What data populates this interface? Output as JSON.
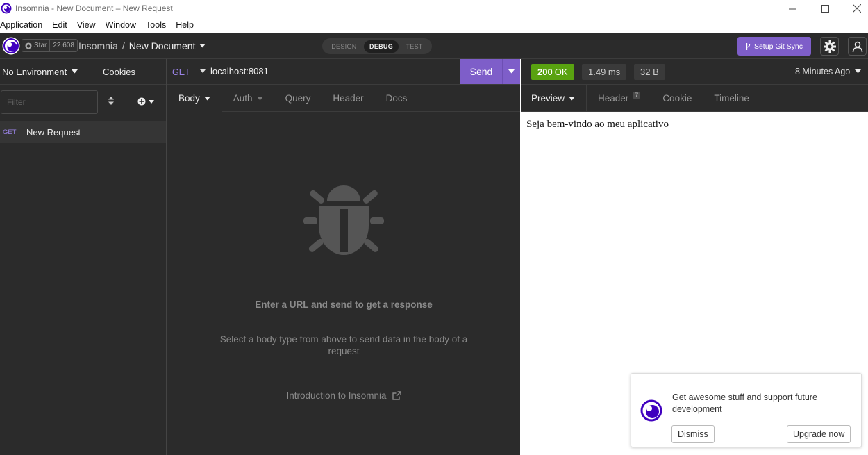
{
  "window": {
    "title": "Insomnia - New Document – New Request"
  },
  "menu": [
    "Application",
    "Edit",
    "View",
    "Window",
    "Tools",
    "Help"
  ],
  "header": {
    "github_star": "Star",
    "github_count": "22.608",
    "workspace": "Insomnia",
    "separator": "/",
    "document": "New Document",
    "modes": [
      "DESIGN",
      "DEBUG",
      "TEST"
    ],
    "active_mode": "DEBUG",
    "git_sync_label": "Setup Git Sync"
  },
  "sidebar": {
    "environment": "No Environment",
    "cookies": "Cookies",
    "filter_placeholder": "Filter",
    "requests": [
      {
        "method": "GET",
        "name": "New Request"
      }
    ]
  },
  "request": {
    "method": "GET",
    "url": "localhost:8081",
    "send_label": "Send",
    "tabs": [
      "Body",
      "Auth",
      "Query",
      "Header",
      "Docs"
    ],
    "empty_title": "Enter a URL and send to get a response",
    "empty_subtitle": "Select a body type from above to send data in the body of a request",
    "intro_link": "Introduction to Insomnia"
  },
  "response": {
    "status_code": "200",
    "status_text": "OK",
    "time": "1.49 ms",
    "size": "32 B",
    "ago": "8 Minutes Ago",
    "tabs": [
      "Preview",
      "Header",
      "Cookie",
      "Timeline"
    ],
    "header_count": "7",
    "preview_body": "Seja bem-vindo ao meu aplicativo"
  },
  "toast": {
    "message": "Get awesome stuff and support future development",
    "dismiss_label": "Dismiss",
    "upgrade_label": "Upgrade now"
  },
  "colors": {
    "accent": "#7e5ec9",
    "status_ok": "#59a210",
    "panel_bg": "#2b2b2b",
    "method_get": "#9b84e8"
  }
}
